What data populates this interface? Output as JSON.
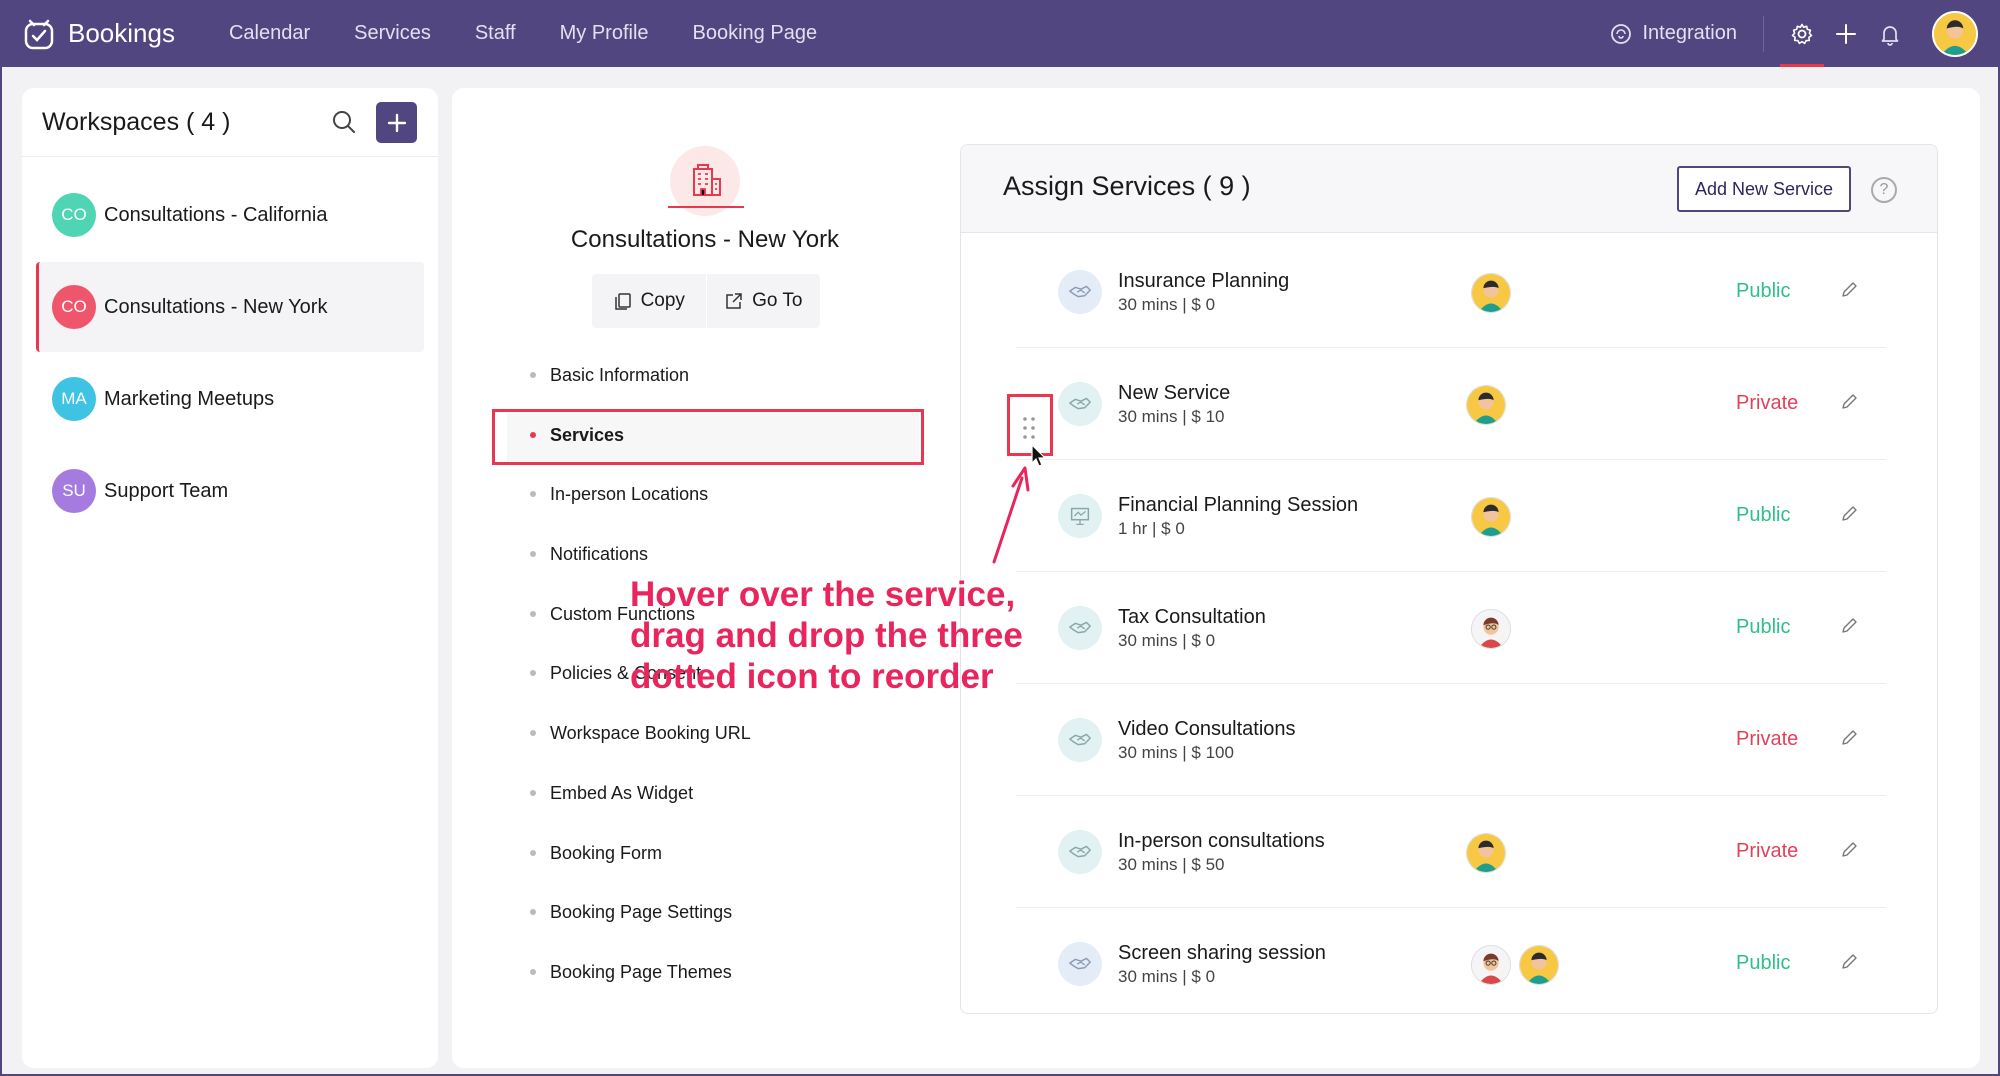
{
  "app": {
    "name": "Bookings"
  },
  "nav": [
    "Calendar",
    "Services",
    "Staff",
    "My Profile",
    "Booking Page"
  ],
  "topbar": {
    "integration_label": "Integration"
  },
  "workspaces": {
    "title": "Workspaces ( 4 )",
    "items": [
      {
        "initials": "CO",
        "name": "Consultations - California",
        "color": "#4fd4b4"
      },
      {
        "initials": "CO",
        "name": "Consultations - New York",
        "color": "#f0566b"
      },
      {
        "initials": "MA",
        "name": "Marketing Meetups",
        "color": "#3ec3e3"
      },
      {
        "initials": "SU",
        "name": "Support Team",
        "color": "#a67be0"
      }
    ]
  },
  "workspace_detail": {
    "name": "Consultations - New York",
    "copy_label": "Copy",
    "goto_label": "Go To",
    "menu": [
      "Basic Information",
      "Services",
      "In-person Locations",
      "Notifications",
      "Custom Functions",
      "Policies & Consent",
      "Workspace Booking URL",
      "Embed As Widget",
      "Booking Form",
      "Booking Page Settings",
      "Booking Page Themes"
    ]
  },
  "services": {
    "title": "Assign Services ( 9 )",
    "add_label": "Add New Service",
    "help": "?",
    "rows": [
      {
        "name": "Insurance Planning",
        "meta": "30 mins | $ 0",
        "visibility": "Public"
      },
      {
        "name": "New Service",
        "meta": "30 mins | $ 10",
        "visibility": "Private"
      },
      {
        "name": "Financial Planning Session",
        "meta": "1 hr | $ 0",
        "visibility": "Public"
      },
      {
        "name": "Tax Consultation",
        "meta": "30 mins | $ 0",
        "visibility": "Public"
      },
      {
        "name": "Video Consultations",
        "meta": "30 mins | $ 100",
        "visibility": "Private"
      },
      {
        "name": "In-person consultations",
        "meta": "30 mins | $ 50",
        "visibility": "Private"
      },
      {
        "name": "Screen sharing session",
        "meta": "30 mins | $ 0",
        "visibility": "Public"
      }
    ]
  },
  "annotation": {
    "line1": "Hover over the service,",
    "line2": "drag and drop the three",
    "line3": "dotted icon to reorder"
  },
  "colors": {
    "header": "#51467f",
    "accent": "#e9374f",
    "public": "#2fbf8a",
    "private": "#e4405a"
  }
}
